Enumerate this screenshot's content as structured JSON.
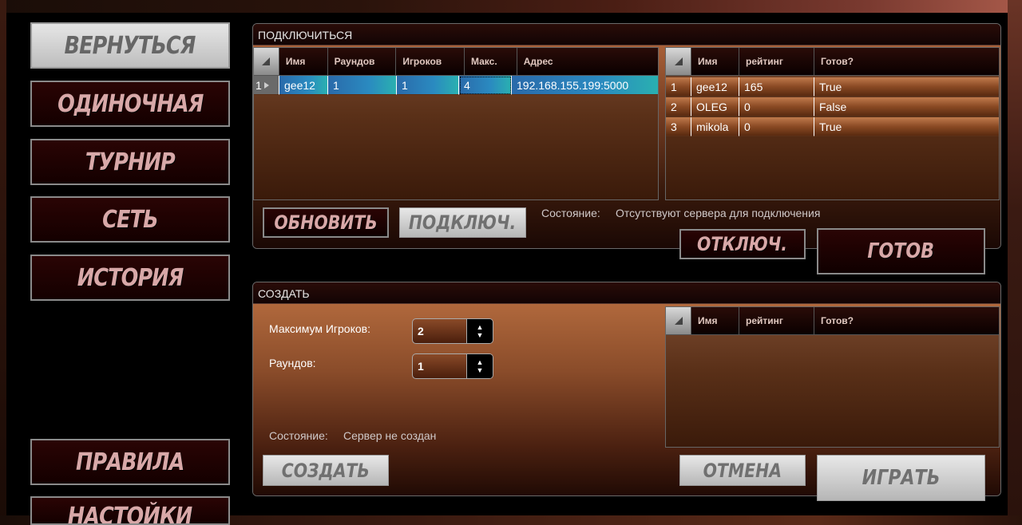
{
  "menu": {
    "back": "ВЕРНУТЬСЯ",
    "single": "ОДИНОЧНАЯ",
    "tournament": "ТУРНИР",
    "network": "СЕТЬ",
    "history": "ИСТОРИЯ",
    "rules": "ПРАВИЛА",
    "settings": "НАСТОЙКИ"
  },
  "connect": {
    "title": "ПОДКЛЮЧИТЬСЯ",
    "servers": {
      "columns": [
        "Имя",
        "Раундов",
        "Игроков",
        "Макс.",
        "Адрес"
      ],
      "rows": [
        {
          "index": "1",
          "name": "gee12",
          "rounds": "1",
          "players": "1",
          "max": "4",
          "address": "192.168.155.199:5000"
        }
      ]
    },
    "players": {
      "columns": [
        "Имя",
        "рейтинг",
        "Готов?"
      ],
      "rows": [
        {
          "index": "1",
          "name": "gee12",
          "rating": "165",
          "ready": "True"
        },
        {
          "index": "2",
          "name": "OLEG",
          "rating": "0",
          "ready": "False"
        },
        {
          "index": "3",
          "name": "mikola",
          "rating": "0",
          "ready": "True"
        }
      ]
    },
    "refresh_label": "ОБНОВИТЬ",
    "connect_label": "ПОДКЛЮЧ.",
    "status_label": "Состояние:",
    "status_value": "Отсутствуют сервера для подключения",
    "disconnect_label": "ОТКЛЮЧ.",
    "ready_label": "ГОТОВ"
  },
  "create": {
    "title": "СОЗДАТЬ",
    "max_players_label": "Максимум Игроков:",
    "max_players_value": "2",
    "rounds_label": "Раундов:",
    "rounds_value": "1",
    "status_label": "Состояние:",
    "status_value": "Сервер не создан",
    "players": {
      "columns": [
        "Имя",
        "рейтинг",
        "Готов?"
      ]
    },
    "create_label": "СОЗДАТЬ",
    "cancel_label": "ОТМЕНА",
    "play_label": "ИГРАТЬ"
  },
  "colors": {
    "selected_row": "#2a8ac0",
    "row_brown": "#8a4a24",
    "menu_text": "#d8a8a8"
  }
}
